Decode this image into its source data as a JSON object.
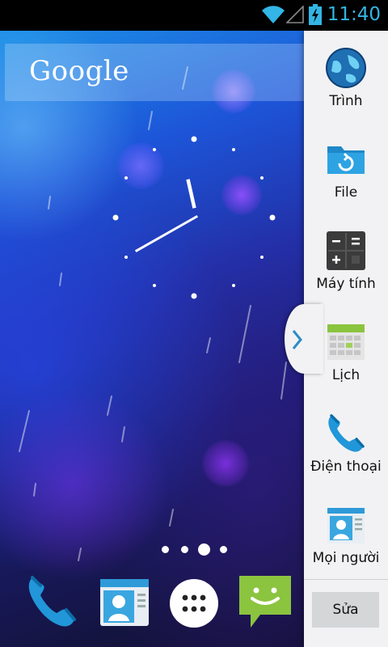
{
  "status_bar": {
    "time": "11:40",
    "icons": [
      "wifi-icon",
      "signal-icon",
      "battery-charging-icon"
    ]
  },
  "search_widget": {
    "logo_text": "Google"
  },
  "home": {
    "page_count": 4,
    "current_page": 3
  },
  "dock": [
    {
      "name": "phone-icon"
    },
    {
      "name": "contacts-icon"
    },
    {
      "name": "app-drawer-icon"
    },
    {
      "name": "messaging-icon"
    }
  ],
  "side_panel": {
    "items": [
      {
        "label": "Trình",
        "icon": "browser-globe-icon"
      },
      {
        "label": "File",
        "icon": "folder-sync-icon"
      },
      {
        "label": "Máy tính",
        "icon": "calculator-icon"
      },
      {
        "label": "Lịch",
        "icon": "calendar-icon"
      },
      {
        "label": "Điện thoại",
        "icon": "phone-icon"
      },
      {
        "label": "Mọi người",
        "icon": "contacts-icon"
      }
    ],
    "edit_label": "Sửa"
  },
  "colors": {
    "accent": "#33b5e5",
    "panel_bg": "#f2f2f4",
    "message_green": "#8bc43f"
  }
}
